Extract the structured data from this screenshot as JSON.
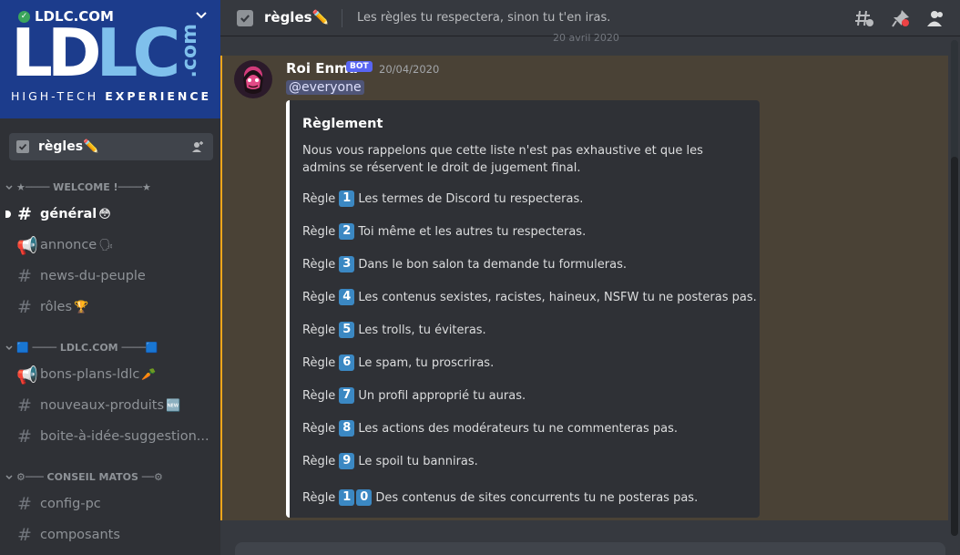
{
  "server": {
    "name": "LDLC.COM",
    "banner_logo": "LDLC",
    "banner_logo_lc": "LC",
    "banner_com": ".com",
    "tagline_left": "HIGH-TECH",
    "tagline_right": "EXPERIENCE"
  },
  "pinned_channel": {
    "label": "règles✏️"
  },
  "categories": [
    {
      "label": "★──── WELCOME !────★"
    },
    {
      "label": "🟦 ──── LDLC.COM ────🟦"
    },
    {
      "label": "⚙─── CONSEIL MATOS ──⚙"
    }
  ],
  "channels": [
    {
      "label": "général",
      "emoji": "😳",
      "type": "text",
      "active": true
    },
    {
      "label": "annonce",
      "emoji": "🗣",
      "type": "announcement"
    },
    {
      "label": "news-du-peuple",
      "emoji": "",
      "type": "text"
    },
    {
      "label": "rôles",
      "emoji": "🏆",
      "type": "text"
    },
    {
      "label": "bons-plans-ldlc",
      "emoji": "🥕",
      "type": "announcement"
    },
    {
      "label": "nouveaux-produits",
      "emoji": "🆕",
      "type": "text"
    },
    {
      "label": "boite-à-idée-suggestion...",
      "emoji": "",
      "type": "text"
    },
    {
      "label": "config-pc",
      "emoji": "",
      "type": "text"
    },
    {
      "label": "composants",
      "emoji": "",
      "type": "text"
    }
  ],
  "topbar": {
    "channel_name": "règles✏️",
    "topic": "Les règles tu respectera, sinon tu t'en iras."
  },
  "date_divider": "20 avril 2020",
  "message": {
    "author": "Roi Enma",
    "bot_tag": "BOT",
    "timestamp": "20/04/2020",
    "mention": "@everyone",
    "embed": {
      "title": "Règlement",
      "description": "Nous vous rappelons que cette liste n'est pas exhaustive et que les admins se réservent le droit de jugement final.",
      "rules": [
        {
          "prefix": "Règle",
          "digits": [
            "1"
          ],
          "text": "Les termes de Discord tu respecteras."
        },
        {
          "prefix": "Règle",
          "digits": [
            "2"
          ],
          "text": "Toi même et les autres tu respecteras."
        },
        {
          "prefix": "Règle",
          "digits": [
            "3"
          ],
          "text": "Dans le bon salon ta demande tu formuleras."
        },
        {
          "prefix": "Règle",
          "digits": [
            "4"
          ],
          "text": "Les contenus sexistes, racistes, haineux, NSFW tu ne posteras pas."
        },
        {
          "prefix": "Règle",
          "digits": [
            "5"
          ],
          "text": "Les trolls, tu éviteras."
        },
        {
          "prefix": "Règle",
          "digits": [
            "6"
          ],
          "text": "Le spam, tu proscriras."
        },
        {
          "prefix": "Règle",
          "digits": [
            "7"
          ],
          "text": "Un profil approprié tu auras."
        },
        {
          "prefix": "Règle",
          "digits": [
            "8"
          ],
          "text": "Les actions des modérateurs tu ne commenteras pas."
        },
        {
          "prefix": "Règle",
          "digits": [
            "9"
          ],
          "text": "Le spoil tu banniras."
        },
        {
          "prefix": "Règle",
          "digits": [
            "1",
            "0"
          ],
          "text": "Des contenus de sites concurrents tu ne posteras pas."
        }
      ]
    }
  },
  "colors": {
    "accent": "#5865f2",
    "mention_highlight": "#faa61a",
    "keycap": "#3b88c3"
  }
}
